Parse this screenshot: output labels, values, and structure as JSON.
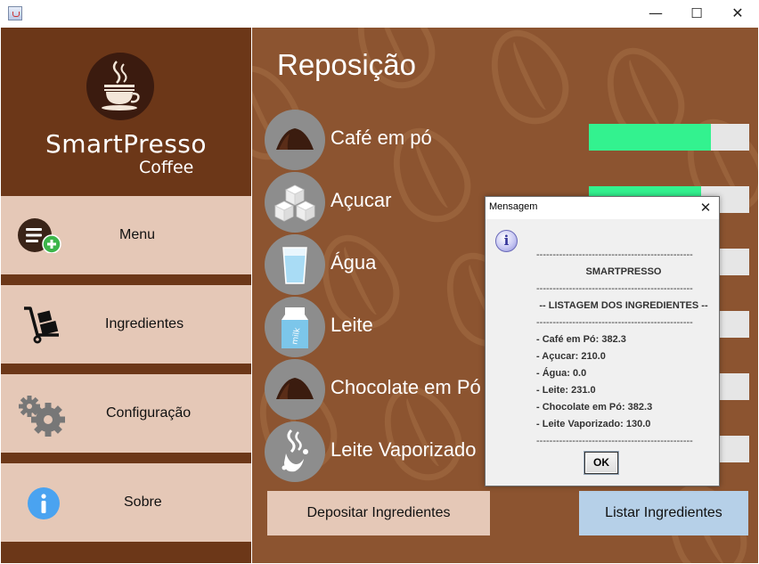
{
  "window": {
    "minimize": "—",
    "maximize": "☐",
    "close": "✕"
  },
  "logo": {
    "name": "SmartPresso",
    "sub": "Coffee"
  },
  "sidebar": {
    "items": [
      {
        "label": "Menu",
        "icon": "menu-add-icon"
      },
      {
        "label": "Ingredientes",
        "icon": "hand-truck-icon"
      },
      {
        "label": "Configuração",
        "icon": "gears-icon"
      },
      {
        "label": "Sobre",
        "icon": "info-icon"
      }
    ]
  },
  "main": {
    "title": "Reposição",
    "ingredients": [
      {
        "name": "Café em pó",
        "icon": "coffee-powder-icon",
        "level": 0.76
      },
      {
        "name": "Açucar",
        "icon": "sugar-cubes-icon",
        "level": 0.7
      },
      {
        "name": "Água",
        "icon": "water-glass-icon",
        "level": 0.0
      },
      {
        "name": "Leite",
        "icon": "milk-carton-icon",
        "level": 0.0
      },
      {
        "name": "Chocolate em Pó",
        "icon": "chocolate-powder-icon",
        "level": 0.0
      },
      {
        "name": "Leite Vaporizado",
        "icon": "steamed-milk-icon",
        "level": 0.0
      }
    ],
    "deposit_label": "Depositar Ingredientes",
    "list_label": "Listar Ingredientes"
  },
  "dialog": {
    "title": "Mensagem",
    "close": "✕",
    "lines": [
      "------------------------------------------------",
      "SMARTPRESSO",
      "------------------------------------------------",
      "-- LISTAGEM DOS INGREDIENTES --",
      "------------------------------------------------",
      "- Café em Pó: 382.3",
      "- Açucar: 210.0",
      "- Água: 0.0",
      "- Leite: 231.0",
      "- Chocolate em Pó: 382.3",
      "- Leite Vaporizado: 130.0",
      "------------------------------------------------"
    ],
    "ok_label": "OK"
  },
  "colors": {
    "sidebar_bg": "#6c3718",
    "nav_item_bg": "#e5c8b7",
    "main_bg": "#8c5430",
    "bar_fill": "#33f28f",
    "deposit_bg": "#e5c8b7",
    "list_bg": "#b6d0e8"
  }
}
